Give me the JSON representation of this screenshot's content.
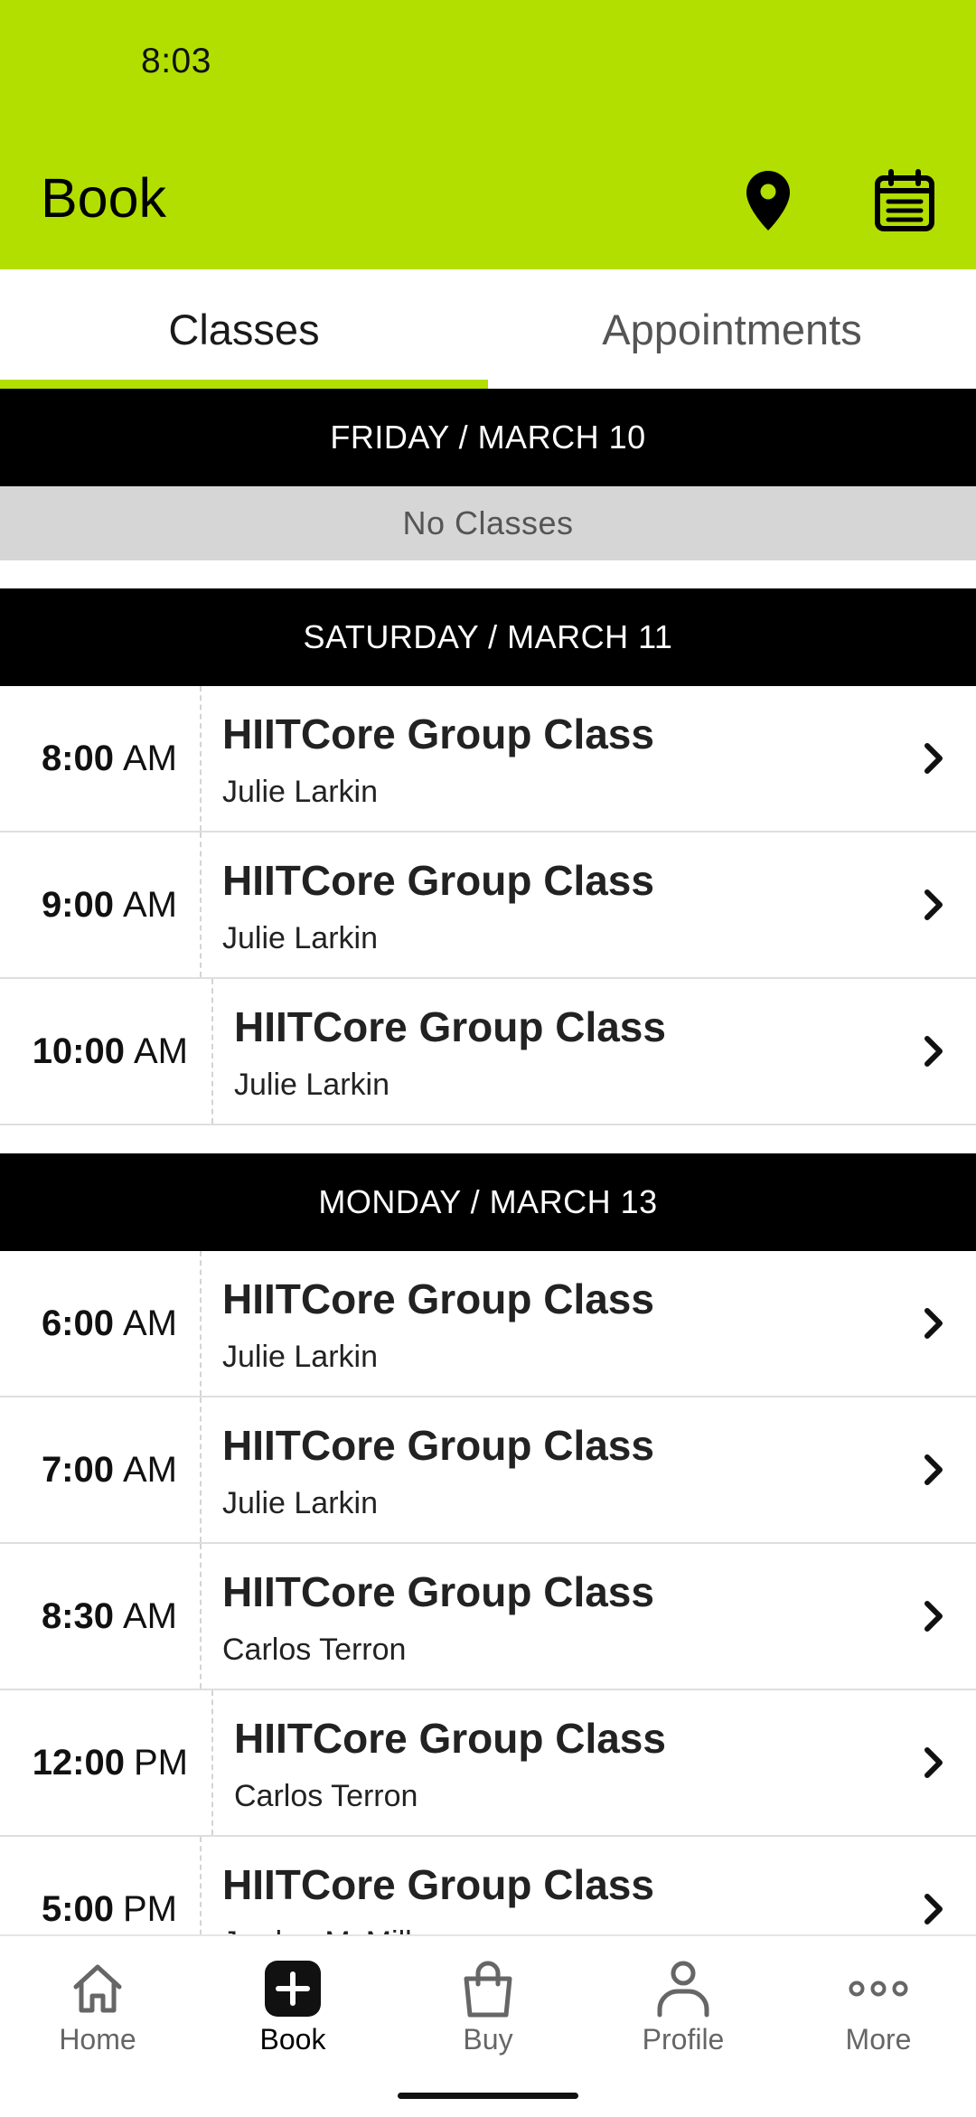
{
  "status_bar": {
    "time": "8:03"
  },
  "app_bar": {
    "title": "Book",
    "location_icon": "location-pin-icon",
    "calendar_icon": "calendar-icon"
  },
  "tabs": [
    {
      "label": "Classes",
      "selected": true
    },
    {
      "label": "Appointments",
      "selected": false
    }
  ],
  "colors": {
    "accent": "#b2df00",
    "header_bg": "#000000",
    "empty_bg": "#d6d6d6"
  },
  "days": [
    {
      "header": "FRIDAY / MARCH 10",
      "empty_text": "No Classes",
      "classes": []
    },
    {
      "header": "SATURDAY / MARCH 11",
      "classes": [
        {
          "time": "8:00",
          "ampm": "AM",
          "name": "HIITCore Group Class",
          "instructor": "Julie Larkin"
        },
        {
          "time": "9:00",
          "ampm": "AM",
          "name": "HIITCore Group Class",
          "instructor": "Julie Larkin"
        },
        {
          "time": "10:00",
          "ampm": "AM",
          "name": "HIITCore Group Class",
          "instructor": "Julie Larkin"
        }
      ]
    },
    {
      "header": "MONDAY / MARCH 13",
      "classes": [
        {
          "time": "6:00",
          "ampm": "AM",
          "name": "HIITCore Group Class",
          "instructor": "Julie Larkin"
        },
        {
          "time": "7:00",
          "ampm": "AM",
          "name": "HIITCore Group Class",
          "instructor": "Julie Larkin"
        },
        {
          "time": "8:30",
          "ampm": "AM",
          "name": "HIITCore Group Class",
          "instructor": "Carlos Terron"
        },
        {
          "time": "12:00",
          "ampm": "PM",
          "name": "HIITCore Group Class",
          "instructor": "Carlos Terron"
        },
        {
          "time": "5:00",
          "ampm": "PM",
          "name": "HIITCore Group Class",
          "instructor": "Jordan McMillan"
        }
      ]
    }
  ],
  "bottom_nav": [
    {
      "label": "Home",
      "icon": "home-icon",
      "active": false
    },
    {
      "label": "Book",
      "icon": "plus-square-icon",
      "active": true
    },
    {
      "label": "Buy",
      "icon": "shopping-bag-icon",
      "active": false
    },
    {
      "label": "Profile",
      "icon": "person-icon",
      "active": false
    },
    {
      "label": "More",
      "icon": "more-dots-icon",
      "active": false
    }
  ]
}
